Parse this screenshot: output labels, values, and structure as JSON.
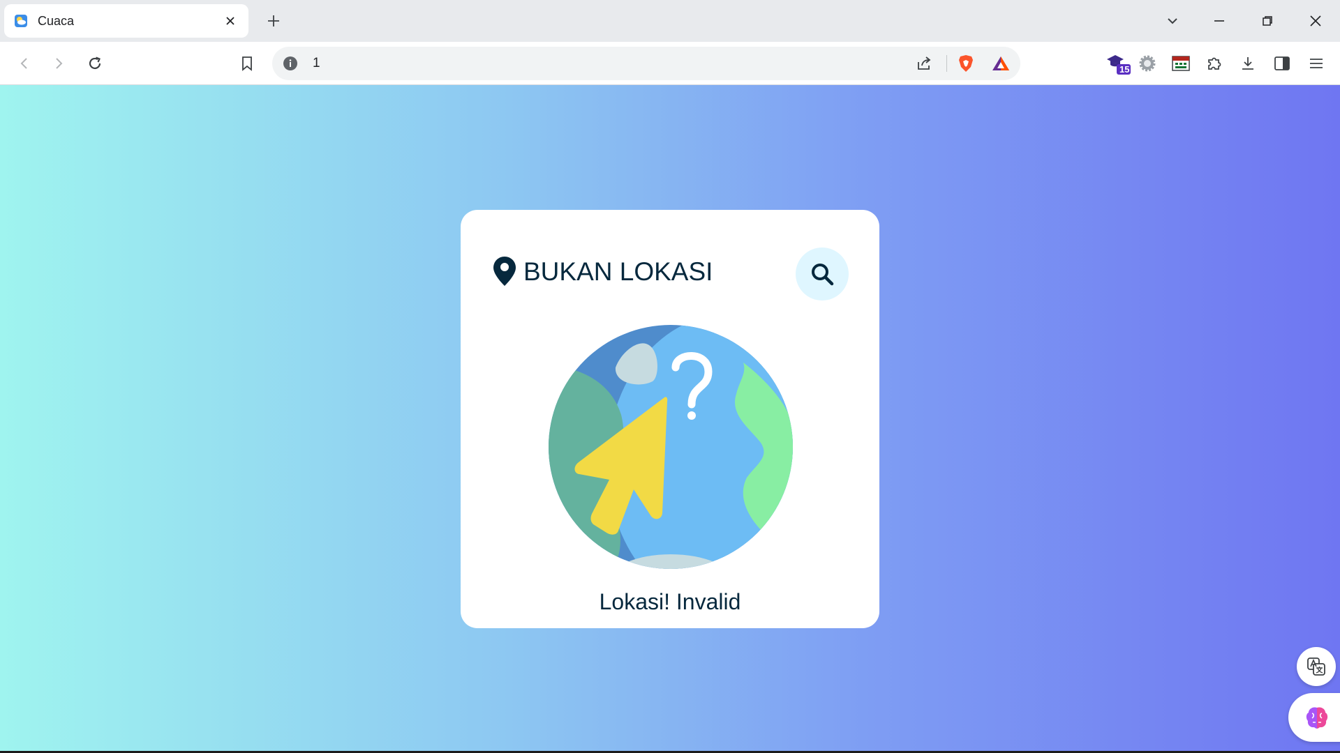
{
  "browser": {
    "tab": {
      "title": "Cuaca",
      "favicon": "weather-icon"
    },
    "url": "1",
    "extensions_badge": "15"
  },
  "search": {
    "value": "BUKAN LOKASI",
    "pin_icon": "location-pin-icon",
    "button_icon": "search-icon"
  },
  "result": {
    "message": "Lokasi! Invalid",
    "illustration": "globe-cursor-question-icon"
  },
  "colors": {
    "gradient_start": "#9ff4ef",
    "gradient_end": "#6f76f2",
    "text_dark": "#06283d",
    "search_button_bg": "#dff6ff"
  }
}
